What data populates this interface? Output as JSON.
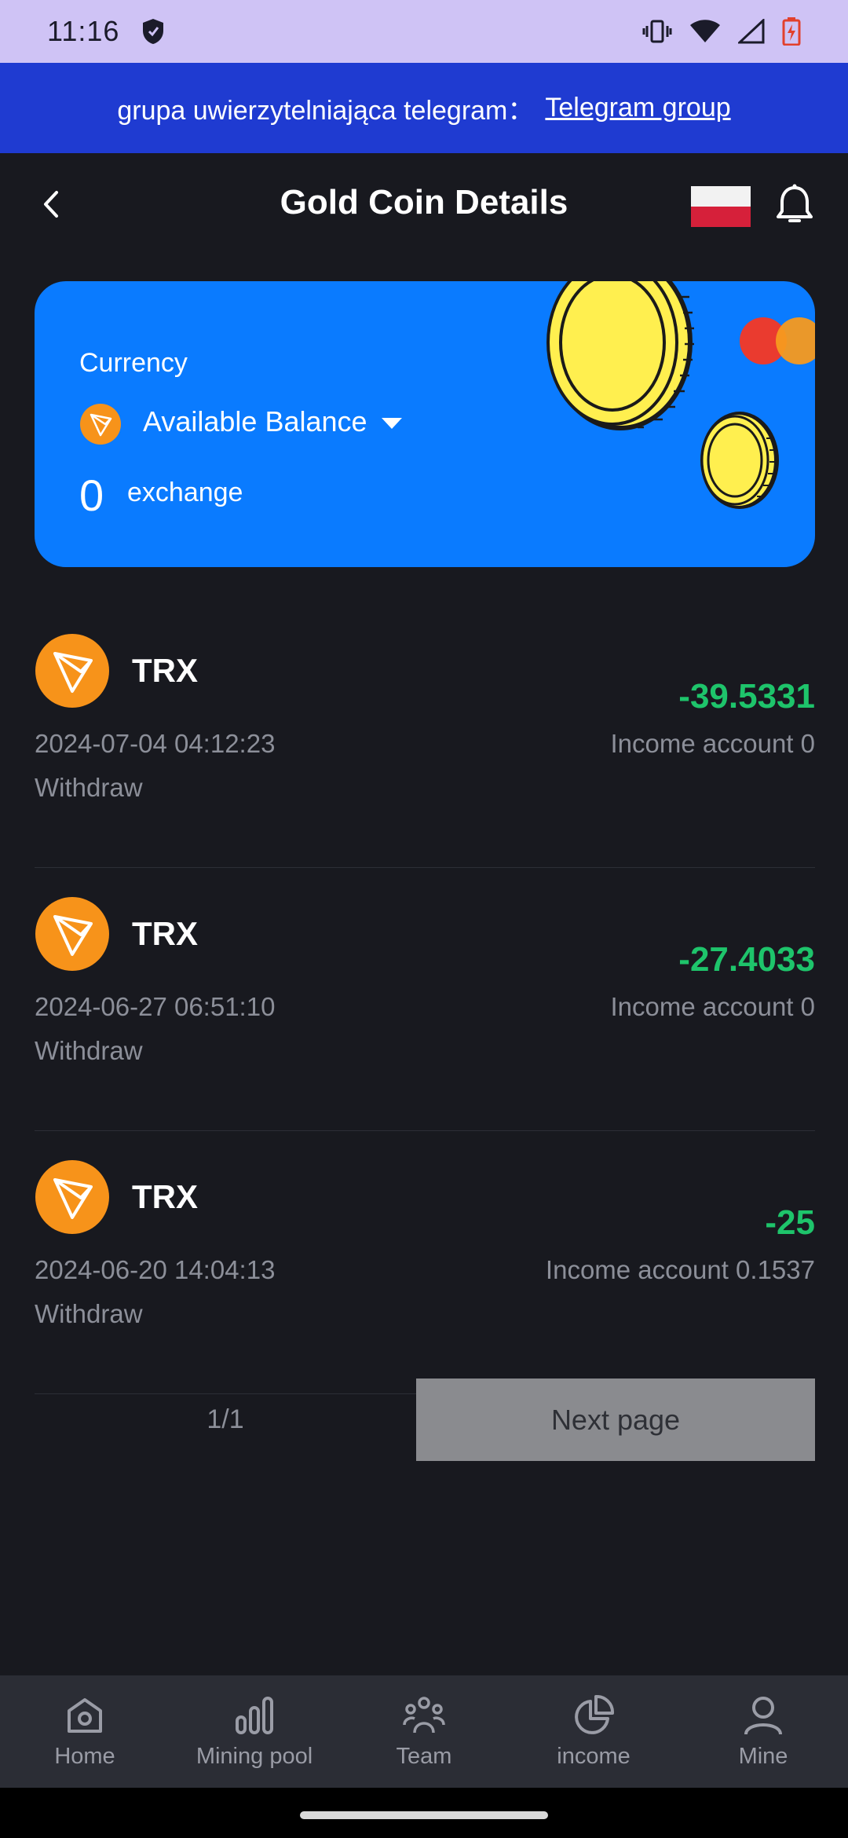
{
  "status_bar": {
    "time": "11:16"
  },
  "banner": {
    "text": "grupa uwierzytelniająca telegram：",
    "link_text": "Telegram group"
  },
  "header": {
    "title": "Gold Coin Details"
  },
  "card": {
    "currency_label": "Currency",
    "balance_selector": "Available Balance",
    "amount": "0",
    "exchange_label": "exchange",
    "accent_color": "#0a7bff"
  },
  "transactions": [
    {
      "coin": "TRX",
      "amount": "-39.5331",
      "date": "2024-07-04 04:12:23",
      "account": "Income account 0",
      "type": "Withdraw"
    },
    {
      "coin": "TRX",
      "amount": "-27.4033",
      "date": "2024-06-27 06:51:10",
      "account": "Income account 0",
      "type": "Withdraw"
    },
    {
      "coin": "TRX",
      "amount": "-25",
      "date": "2024-06-20 14:04:13",
      "account": "Income account 0.1537",
      "type": "Withdraw"
    }
  ],
  "pagination": {
    "indicator": "1/1",
    "next_label": "Next page"
  },
  "bottom_nav": {
    "items": [
      {
        "label": "Home",
        "icon": "home-icon"
      },
      {
        "label": "Mining pool",
        "icon": "bar-chart-icon"
      },
      {
        "label": "Team",
        "icon": "team-icon"
      },
      {
        "label": "income",
        "icon": "pie-chart-icon"
      },
      {
        "label": "Mine",
        "icon": "user-icon"
      }
    ]
  },
  "colors": {
    "background": "#18191f",
    "banner": "#1f3bd1",
    "positive_green": "#1ec46b",
    "coin_orange": "#f7931a"
  }
}
